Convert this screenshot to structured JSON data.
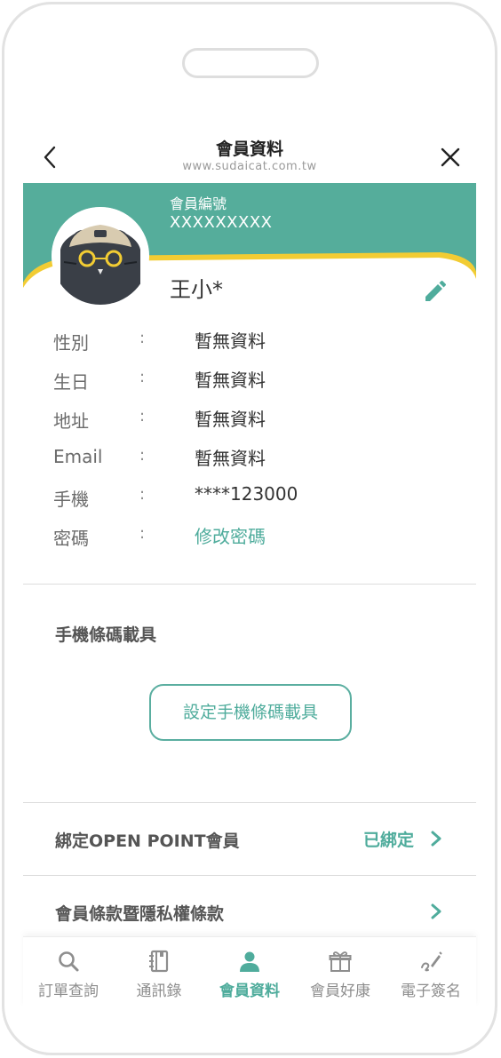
{
  "header": {
    "title": "會員資料",
    "url": "www.sudaicat.com.tw"
  },
  "member": {
    "number_label": "會員編號",
    "number_value": "XXXXXXXXX",
    "name": "王小*"
  },
  "info": [
    {
      "label": "性別",
      "colon": ":",
      "value": "暫無資料"
    },
    {
      "label": "生日",
      "colon": ":",
      "value": "暫無資料"
    },
    {
      "label": "地址",
      "colon": ":",
      "value": "暫無資料"
    },
    {
      "label": "Email",
      "colon": ":",
      "value": "暫無資料"
    },
    {
      "label": "手機",
      "colon": ":",
      "value": "****123000"
    },
    {
      "label": "密碼",
      "colon": ":",
      "value": "修改密碼"
    }
  ],
  "carrier": {
    "section_title": "手機條碼載具",
    "button_label": "設定手機條碼載具"
  },
  "rows": {
    "openpoint_label": "綁定OPEN POINT會員",
    "openpoint_status": "已綁定",
    "terms_label": "會員條款暨隱私權條款"
  },
  "tabs": [
    {
      "label": "訂單查詢",
      "icon": "search-icon",
      "active": false
    },
    {
      "label": "通訊錄",
      "icon": "address-book-icon",
      "active": false
    },
    {
      "label": "會員資料",
      "icon": "person-icon",
      "active": true
    },
    {
      "label": "會員好康",
      "icon": "gift-icon",
      "active": false
    },
    {
      "label": "電子簽名",
      "icon": "signature-icon",
      "active": false
    }
  ],
  "colors": {
    "accent": "#4fac9c",
    "banner": "#55ad9b",
    "banner_stripe": "#f2cc33"
  }
}
